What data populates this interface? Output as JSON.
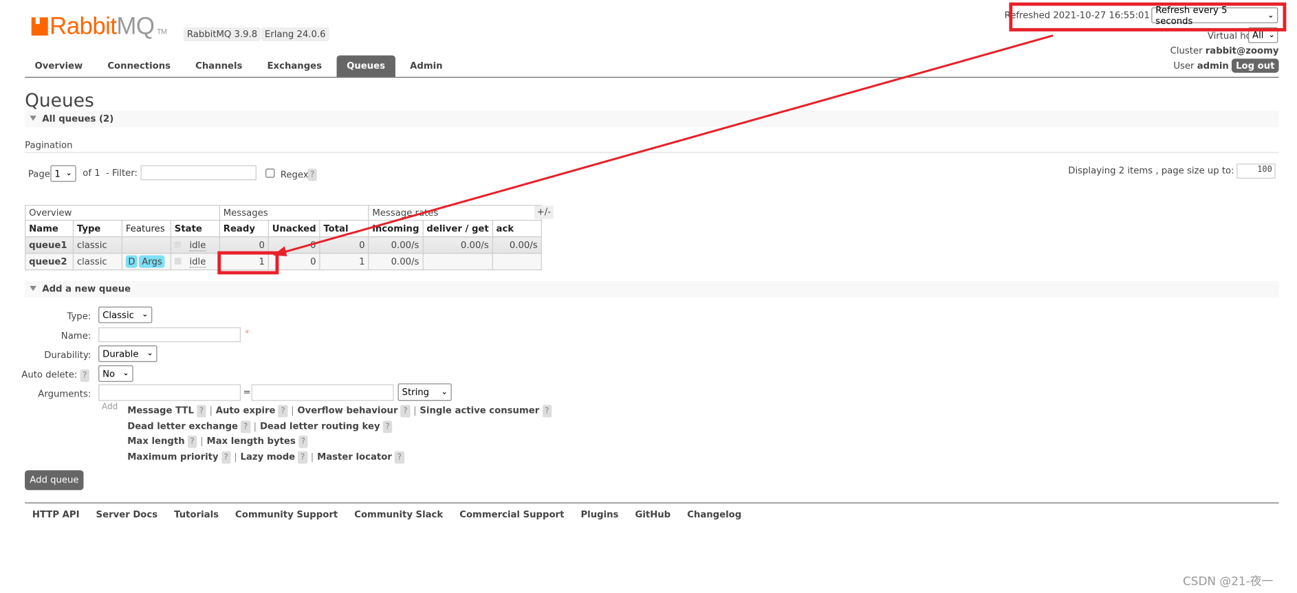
{
  "header": {
    "logo_text_a": "Rabbit",
    "logo_text_b": "MQ",
    "logo_tm": "TM",
    "version": "RabbitMQ 3.9.8",
    "erlang": "Erlang 24.0.6",
    "refreshed": "Refreshed 2021-10-27 16:55:01",
    "refresh_select": "Refresh every 5 seconds",
    "vhost_label": "Virtual host",
    "vhost_value": "All",
    "cluster_label": "Cluster",
    "cluster_value": "rabbit@zoomy",
    "user_label": "User",
    "user_value": "admin",
    "logout": "Log out"
  },
  "nav": {
    "tabs": [
      {
        "label": "Overview"
      },
      {
        "label": "Connections"
      },
      {
        "label": "Channels"
      },
      {
        "label": "Exchanges"
      },
      {
        "label": "Queues",
        "active": true
      },
      {
        "label": "Admin"
      }
    ]
  },
  "page": {
    "title": "Queues",
    "all_queues": "All queues (2)",
    "pagination": "Pagination",
    "page_label": "Page",
    "page_value": "1",
    "of": "of 1",
    "filter_label": "- Filter:",
    "regex": "Regex",
    "help": "?",
    "displaying": "Displaying 2 items , page size up to:",
    "page_size": "100"
  },
  "table": {
    "groups": [
      "Overview",
      "Messages",
      "Message rates"
    ],
    "plusminus": "+/-",
    "columns": [
      "Name",
      "Type",
      "Features",
      "State",
      "Ready",
      "Unacked",
      "Total",
      "incoming",
      "deliver / get",
      "ack"
    ],
    "rows": [
      {
        "name": "queue1",
        "type": "classic",
        "features": [],
        "state": "idle",
        "ready": "0",
        "unacked": "0",
        "total": "0",
        "incoming": "0.00/s",
        "deliver_get": "0.00/s",
        "ack": "0.00/s"
      },
      {
        "name": "queue2",
        "type": "classic",
        "features": [
          "D",
          "Args"
        ],
        "state": "idle",
        "ready": "1",
        "unacked": "0",
        "total": "1",
        "incoming": "0.00/s",
        "deliver_get": "",
        "ack": ""
      }
    ]
  },
  "add_queue": {
    "section": "Add a new queue",
    "type_label": "Type:",
    "type_value": "Classic",
    "name_label": "Name:",
    "required": "*",
    "durability_label": "Durability:",
    "durability_value": "Durable",
    "autodelete_label": "Auto delete:",
    "autodelete_value": "No",
    "arguments_label": "Arguments:",
    "equals": "=",
    "arg_type": "String",
    "add": "Add",
    "arg_links": [
      [
        "Message TTL",
        "Auto expire",
        "Overflow behaviour",
        "Single active consumer"
      ],
      [
        "Dead letter exchange",
        "Dead letter routing key"
      ],
      [
        "Max length",
        "Max length bytes"
      ],
      [
        "Maximum priority",
        "Lazy mode",
        "Master locator"
      ]
    ],
    "button": "Add queue"
  },
  "footer": {
    "links": [
      "HTTP API",
      "Server Docs",
      "Tutorials",
      "Community Support",
      "Community Slack",
      "Commercial Support",
      "Plugins",
      "GitHub",
      "Changelog"
    ]
  },
  "watermark": "CSDN @21-夜一",
  "annotation_color": "#e8202a"
}
